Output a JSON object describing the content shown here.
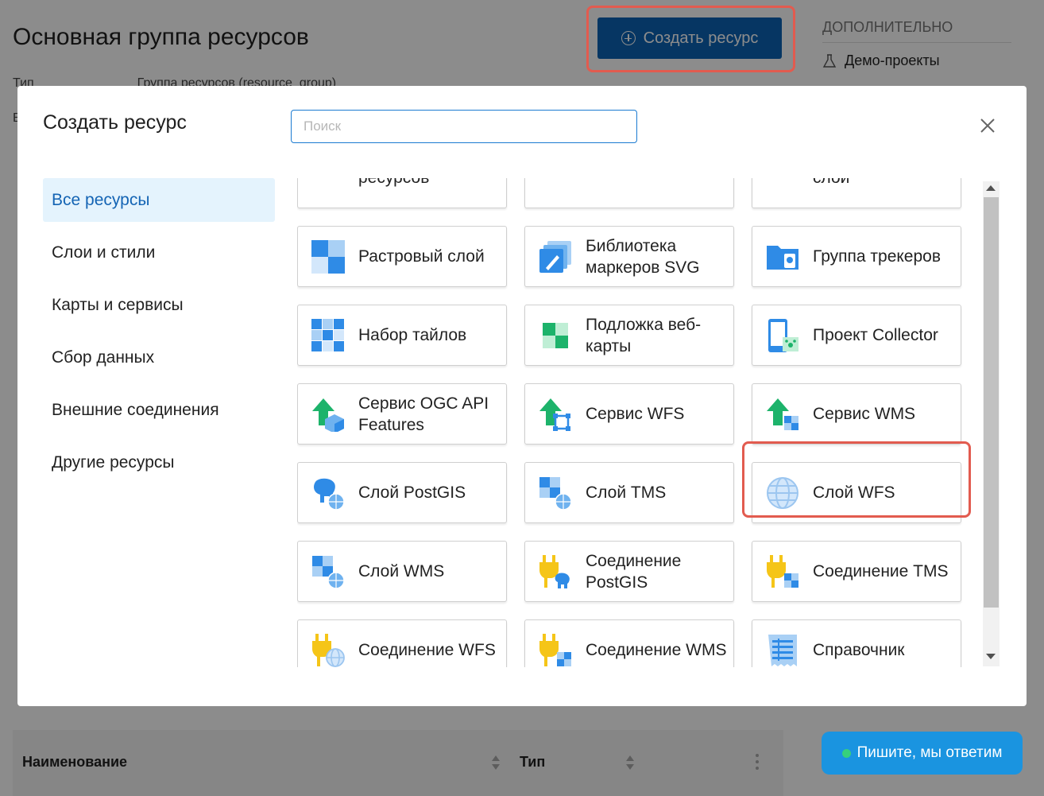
{
  "background": {
    "page_title": "Основная группа ресурсов",
    "create_button": "Создать ресурс",
    "meta_type_label": "Тип",
    "meta_type_value": "Группа ресурсов (resource_group)",
    "meta_second_letter": "В",
    "sidebar_heading": "ДОПОЛНИТЕЛЬНО",
    "sidebar_item": "Демо-проекты",
    "table_col_name": "Наименование",
    "table_col_type": "Тип",
    "chat_button": "Пишите, мы ответим"
  },
  "modal": {
    "title": "Создать ресурс",
    "search_placeholder": "Поиск",
    "search_value": "",
    "categories": [
      {
        "label": "Все ресурсы",
        "active": true
      },
      {
        "label": "Слои и стили",
        "active": false
      },
      {
        "label": "Карты и сервисы",
        "active": false
      },
      {
        "label": "Сбор данных",
        "active": false
      },
      {
        "label": "Внешние соединения",
        "active": false
      },
      {
        "label": "Другие ресурсы",
        "active": false
      }
    ],
    "cards": [
      {
        "label": "ресурсов",
        "icon": "partial-icon"
      },
      {
        "label": "",
        "icon": "partial-icon"
      },
      {
        "label": "слой",
        "icon": "partial-icon"
      },
      {
        "label": "Растровый слой",
        "icon": "raster-layer-icon"
      },
      {
        "label": "Библиотека маркеров SVG",
        "icon": "svg-marker-library-icon"
      },
      {
        "label": "Группа трекеров",
        "icon": "tracker-group-icon"
      },
      {
        "label": "Набор тайлов",
        "icon": "tileset-icon"
      },
      {
        "label": "Подложка веб-карты",
        "icon": "basemap-icon"
      },
      {
        "label": "Проект Collector",
        "icon": "collector-project-icon"
      },
      {
        "label": "Сервис OGC API Features",
        "icon": "ogc-api-service-icon"
      },
      {
        "label": "Сервис WFS",
        "icon": "wfs-service-icon"
      },
      {
        "label": "Сервис WMS",
        "icon": "wms-service-icon"
      },
      {
        "label": "Слой PostGIS",
        "icon": "postgis-layer-icon"
      },
      {
        "label": "Слой TMS",
        "icon": "tms-layer-icon"
      },
      {
        "label": "Слой WFS",
        "icon": "wfs-layer-icon"
      },
      {
        "label": "Слой WMS",
        "icon": "wms-layer-icon"
      },
      {
        "label": "Соединение PostGIS",
        "icon": "postgis-connection-icon"
      },
      {
        "label": "Соединение TMS",
        "icon": "tms-connection-icon"
      },
      {
        "label": "Соединение WFS",
        "icon": "wfs-connection-icon"
      },
      {
        "label": "Соединение WMS",
        "icon": "wms-connection-icon"
      },
      {
        "label": "Справочник",
        "icon": "lookup-table-icon"
      }
    ]
  },
  "colors": {
    "primary_button": "#0b63b5",
    "active_category_bg": "#e4f3fd",
    "active_category_text": "#1464b4",
    "highlight": "#e25b4f",
    "chat_button": "#1a94e0",
    "icon_blue": "#2f8be6",
    "icon_green": "#1db36b",
    "icon_yellow": "#f5c518"
  }
}
